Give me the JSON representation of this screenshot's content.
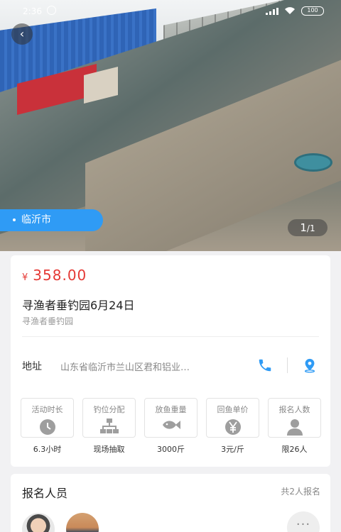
{
  "status": {
    "time": "2:36",
    "battery": "100"
  },
  "hero": {
    "city": "临沂市",
    "page_current": "1",
    "page_total": "/1"
  },
  "detail": {
    "currency": "¥",
    "price": "358.00",
    "title": "寻渔者垂钓园6月24日",
    "venue": "寻渔者垂钓园",
    "address_label": "地址",
    "address": "山东省临沂市兰山区君和铝业…",
    "stats": [
      {
        "title": "活动时长",
        "icon": "clock-icon",
        "value": "6.3小时"
      },
      {
        "title": "钓位分配",
        "icon": "hierarchy-icon",
        "value": "现场抽取"
      },
      {
        "title": "放鱼重量",
        "icon": "fish-icon",
        "value": "3000斤"
      },
      {
        "title": "回鱼单价",
        "icon": "yen-icon",
        "value": "3元/斤"
      },
      {
        "title": "报名人数",
        "icon": "person-icon",
        "value": "限26人"
      }
    ]
  },
  "registrants": {
    "title": "报名人员",
    "count": "共2人报名",
    "more": "···"
  },
  "colors": {
    "accent": "#2f9bf5",
    "price": "#e53935",
    "icon_gray": "#9e9e9e"
  }
}
